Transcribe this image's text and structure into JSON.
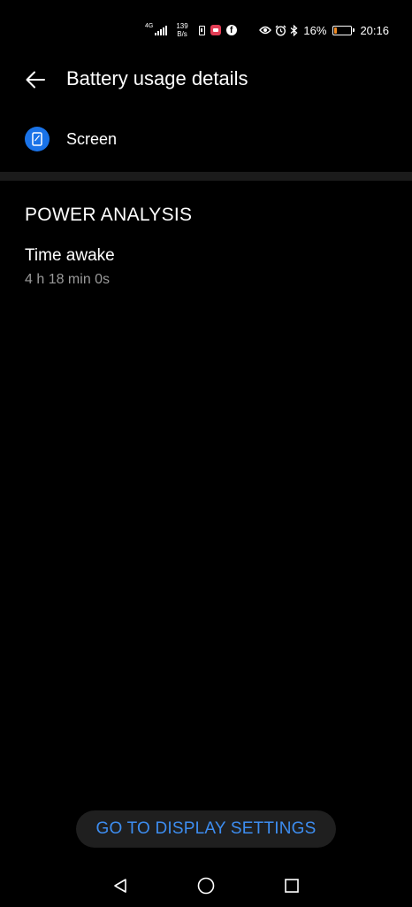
{
  "status_bar": {
    "network_type": "4G",
    "net_speed_value": "139",
    "net_speed_unit": "B/s",
    "icons": [
      "sim-icon",
      "app-notification-icon",
      "facebook-icon",
      "eye-icon",
      "alarm-icon",
      "bluetooth-icon"
    ],
    "battery_percent": "16%",
    "battery_level": 0.16,
    "battery_color": "#f08a24",
    "time": "20:16"
  },
  "header": {
    "title": "Battery usage details",
    "back_icon": "arrow-left-icon"
  },
  "item": {
    "label": "Screen",
    "icon": "phone-screen-icon",
    "icon_color": "#1a73e8"
  },
  "section": {
    "title": "POWER ANALYSIS",
    "stat_label": "Time awake",
    "stat_value": "4 h 18 min 0s"
  },
  "action": {
    "button_label": "GO TO DISPLAY SETTINGS",
    "accent_color": "#3d8df0"
  },
  "nav_bar": {
    "buttons": [
      "back-triangle-icon",
      "home-circle-icon",
      "recents-square-icon"
    ]
  }
}
